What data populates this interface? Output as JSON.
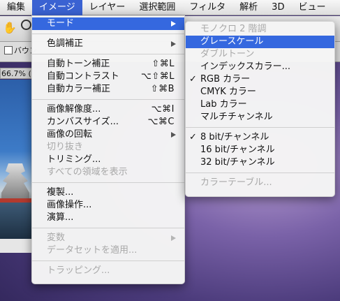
{
  "menubar": {
    "items": [
      {
        "label": "編集",
        "active": false
      },
      {
        "label": "イメージ",
        "active": true
      },
      {
        "label": "レイヤー",
        "active": false
      },
      {
        "label": "選択範囲",
        "active": false
      },
      {
        "label": "フィルタ",
        "active": false
      },
      {
        "label": "解析",
        "active": false
      },
      {
        "label": "3D",
        "active": false
      },
      {
        "label": "ビュー",
        "active": false
      }
    ]
  },
  "toolbar": {
    "bounding_label": "バウン",
    "zoom_label": "66.7% ("
  },
  "image_menu": {
    "mode": "モード",
    "adjustments": "色調補正",
    "auto_tone": "自動トーン補正",
    "auto_tone_sc": "⇧⌘L",
    "auto_contrast": "自動コントラスト",
    "auto_contrast_sc": "⌥⇧⌘L",
    "auto_color": "自動カラー補正",
    "auto_color_sc": "⇧⌘B",
    "image_size": "画像解像度...",
    "image_size_sc": "⌥⌘I",
    "canvas_size": "カンバスサイズ...",
    "canvas_size_sc": "⌥⌘C",
    "rotation": "画像の回転",
    "crop": "切り抜き",
    "trim": "トリミング...",
    "reveal_all": "すべての領域を表示",
    "duplicate": "複製...",
    "apply_image": "画像操作...",
    "calculations": "演算...",
    "variables": "変数",
    "apply_dataset": "データセットを適用...",
    "trap": "トラッピング..."
  },
  "mode_submenu": {
    "bitmap": "モノクロ 2 階調",
    "grayscale": "グレースケール",
    "duotone": "ダブルトーン",
    "indexed": "インデックスカラー...",
    "rgb": "RGB カラー",
    "cmyk": "CMYK カラー",
    "lab": "Lab カラー",
    "multichannel": "マルチチャンネル",
    "bit8": "8 bit/チャンネル",
    "bit16": "16 bit/チャンネル",
    "bit32": "32 bit/チャンネル",
    "color_table": "カラーテーブル...",
    "checkmark": "✓"
  },
  "colors": {
    "highlight": "#3568df",
    "active_menu": "#3a62d2"
  }
}
